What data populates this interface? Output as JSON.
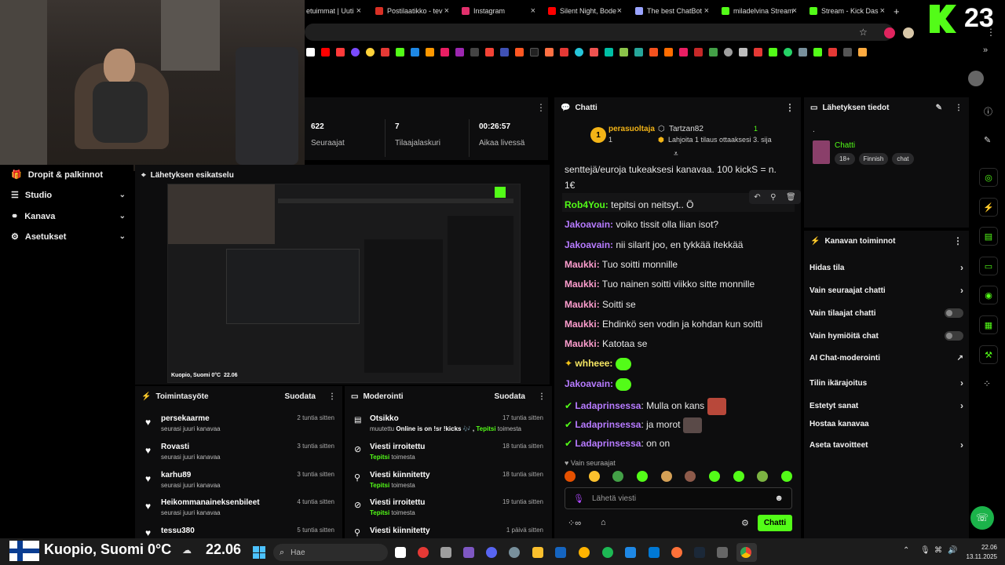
{
  "browser": {
    "tabs": [
      {
        "label": "etuimmat | Uuti"
      },
      {
        "label": "Postilaatikko - tev"
      },
      {
        "label": "Instagram"
      },
      {
        "label": "Silent Night, Bode"
      },
      {
        "label": "The best ChatBot"
      },
      {
        "label": "miladelvina Stream"
      },
      {
        "label": "Stream - Kick Das"
      }
    ],
    "new_tab": "+",
    "viewer_count_badge": "23"
  },
  "stats": {
    "followers": {
      "value": "622",
      "label": "Seuraajat"
    },
    "sub_counter": {
      "value": "7",
      "label": "Tilaajalaskuri"
    },
    "live_time": {
      "value": "00:26:57",
      "label": "Aikaa livessä"
    }
  },
  "sidebar": {
    "items": [
      {
        "label": "Dropit & palkinnot"
      },
      {
        "label": "Studio"
      },
      {
        "label": "Kanava"
      },
      {
        "label": "Asetukset"
      }
    ]
  },
  "preview": {
    "title": "Lähetyksen esikatselu",
    "overlay_location": "Kuopio, Suomi 0°C",
    "overlay_time": "22.06"
  },
  "activity": {
    "title": "Toimintasyöte",
    "filter": "Suodata",
    "items": [
      {
        "name": "persekaarme",
        "sub": "seurasi juuri kanavaa",
        "time": "2 tuntia sitten"
      },
      {
        "name": "Rovasti",
        "sub": "seurasi juuri kanavaa",
        "time": "3 tuntia sitten"
      },
      {
        "name": "karhu89",
        "sub": "seurasi juuri kanavaa",
        "time": "3 tuntia sitten"
      },
      {
        "name": "Heikommanaineksenbileet",
        "sub": "seurasi juuri kanavaa",
        "time": "4 tuntia sitten"
      },
      {
        "name": "tessu380",
        "sub": "",
        "time": "5 tuntia sitten"
      }
    ]
  },
  "moderation": {
    "title": "Moderointi",
    "filter": "Suodata",
    "items": [
      {
        "name": "Otsikko",
        "sub_pre": "muutettu ",
        "sub_bold": "Online is on !sr !kicks 🎶 , ",
        "sub_user": "Tepitsi",
        "sub_post": " toimesta",
        "time": "17 tuntia sitten"
      },
      {
        "name": "Viesti irroitettu",
        "sub_user": "Tepitsi",
        "sub_post": " toimesta",
        "time": "18 tuntia sitten"
      },
      {
        "name": "Viesti kiinnitetty",
        "sub_user": "Tepitsi",
        "sub_post": " toimesta",
        "time": "18 tuntia sitten"
      },
      {
        "name": "Viesti irroitettu",
        "sub_user": "Tepitsi",
        "sub_post": " toimesta",
        "time": "19 tuntia sitten"
      },
      {
        "name": "Viesti kiinnitetty",
        "time": "1 päivä sitten"
      }
    ]
  },
  "chat": {
    "title": "Chatti",
    "top_gifter": {
      "rank": "1",
      "name": "perasuoltaja",
      "count": "1"
    },
    "second": {
      "name": "Tartzan82",
      "count": "1"
    },
    "gift_prompt": "Lahjoita 1 tilaus ottaaksesi 3. sija",
    "messages": [
      {
        "user": "",
        "text": "senttejä/euroja tukeaksesi kanavaa. 100 kickS = n."
      },
      {
        "user": "",
        "text": "1€"
      },
      {
        "user": "Rob4You",
        "text": " tepitsi on neitsyt.. Ö",
        "color": "#53fc18"
      },
      {
        "user": "Jakoavain",
        "text": " voiko tissit olla liian isot?",
        "color": "#b77bff"
      },
      {
        "user": "Jakoavain",
        "text": " nii silarit joo, en tykkää itekkää",
        "color": "#b77bff"
      },
      {
        "user": "Maukki",
        "text": " Tuo soitti monnille",
        "color": "#ff9ecf"
      },
      {
        "user": "Maukki",
        "text": " Tuo nainen soitti viikko sitte monnille",
        "color": "#ff9ecf"
      },
      {
        "user": "Maukki",
        "text": " Soitti se",
        "color": "#ff9ecf"
      },
      {
        "user": "Maukki",
        "text": " Ehdinkö sen vodin ja kohdan kun soitti",
        "color": "#ff9ecf"
      },
      {
        "user": "Maukki",
        "text": " Katotaa se",
        "color": "#ff9ecf"
      },
      {
        "user": "whheee",
        "text": ":",
        "color": "#f5e663"
      },
      {
        "user": "Jakoavain",
        "text": ":",
        "color": "#b77bff"
      },
      {
        "user": "Ladaprinsessa",
        "text": ": Mulla on kans",
        "color": "#b77bff"
      },
      {
        "user": "Ladaprinsessa",
        "text": ": ja morot",
        "color": "#b77bff"
      },
      {
        "user": "Ladaprinsessa",
        "text": ": on on",
        "color": "#b77bff"
      }
    ],
    "followers_only": "Vain seuraajat",
    "input_placeholder": "Lähetä viesti",
    "send_label": "Chatti"
  },
  "stream_info": {
    "title": "Lähetyksen tiedot",
    "dot": ".",
    "category": "Chatti",
    "tags": [
      "18+",
      "Finnish",
      "chat"
    ]
  },
  "channel_actions": {
    "title": "Kanavan toiminnot",
    "items": [
      {
        "label": "Hidas tila",
        "control": "chevron"
      },
      {
        "label": "Vain seuraajat chatti",
        "control": "chevron"
      },
      {
        "label": "Vain tilaajat chatti",
        "control": "toggle"
      },
      {
        "label": "Vain hymiöitä chat",
        "control": "toggle"
      },
      {
        "label": "AI Chat-moderointi",
        "control": "external"
      },
      {
        "label": "Tilin ikärajoitus",
        "control": "chevron"
      },
      {
        "label": "Estetyt sanat",
        "control": "chevron"
      },
      {
        "label": "Hostaa kanavaa",
        "control": "none"
      },
      {
        "label": "Aseta tavoitteet",
        "control": "chevron"
      }
    ]
  },
  "taskbar": {
    "weather_location": "Kuopio, Suomi 0°C",
    "weather_time": "22.06",
    "search_placeholder": "Hae",
    "clock_time": "22.06",
    "clock_date": "13.11.2025"
  },
  "colors": {
    "accent": "#53fc18",
    "panel": "#0d0d0e",
    "background": "#000000"
  }
}
